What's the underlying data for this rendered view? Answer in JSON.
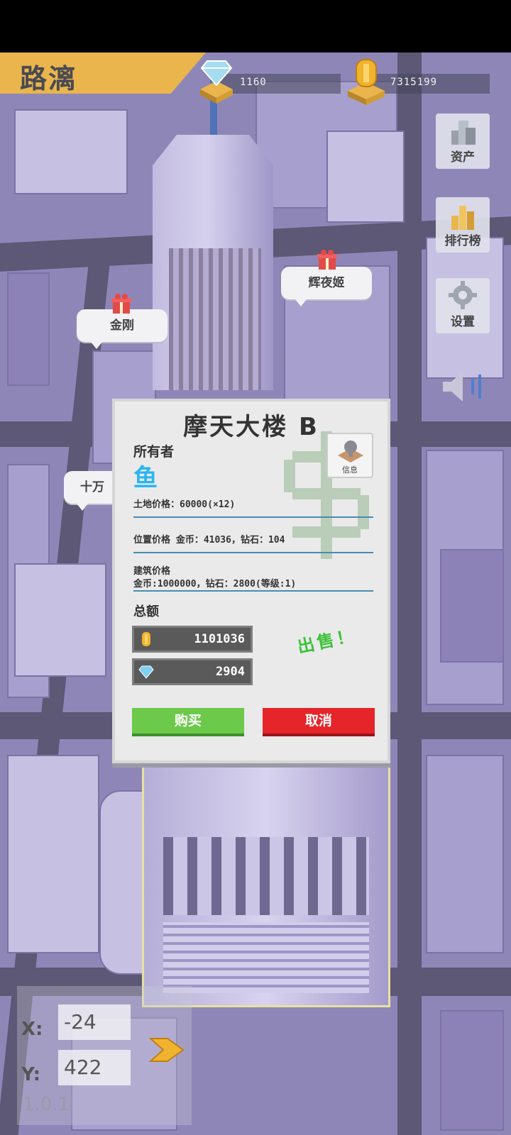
{
  "player_name": "路漓",
  "resources": {
    "diamonds": "1160",
    "coins": "7315199"
  },
  "side_menu": {
    "assets": "资产",
    "leaderboard": "排行榜",
    "settings": "设置"
  },
  "bubbles": {
    "b1": "金刚",
    "b2": "辉夜姬",
    "b3": "十万"
  },
  "dialog": {
    "title": "摩天大楼 B",
    "owner_label": "所有者",
    "owner_value": "鱼",
    "info_label": "信息",
    "land_price": "土地价格：60000(×12)",
    "location_price": "位置价格 金币：41036，钻石：104",
    "building_price_label": "建筑价格",
    "building_price": "金币:1000000，钻石：2800(等级:1)",
    "total_label": "总额",
    "total_coins": "1101036",
    "total_diamonds": "2904",
    "sell_tag": "出售！",
    "buy_label": "购买",
    "cancel_label": "取消"
  },
  "coords": {
    "x_label": "X:",
    "x": "-24",
    "y_label": "Y:",
    "y": "422"
  },
  "version": "1.0.1"
}
